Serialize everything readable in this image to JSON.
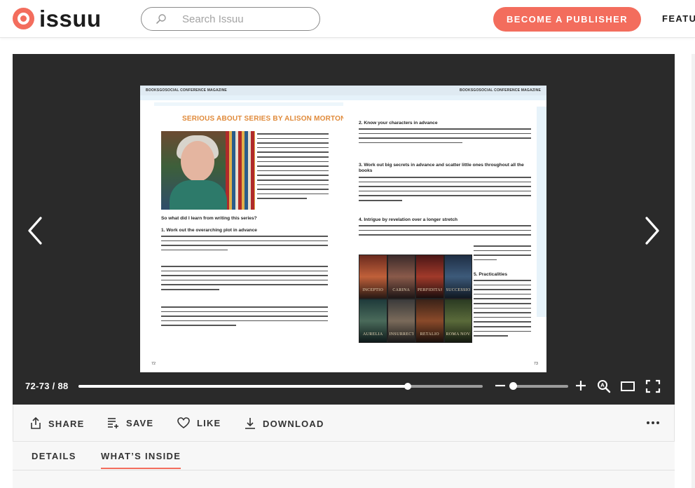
{
  "header": {
    "logo_text": "issuu",
    "search_placeholder": "Search Issuu",
    "publisher_button": "BECOME A PUBLISHER",
    "features_link": "FEATURES",
    "brand_color": "#f36d5d"
  },
  "viewer": {
    "page_indicator": "72-73 / 88",
    "current_pages": "72-73",
    "total_pages": 88,
    "progress_fraction": 0.815,
    "zoom_fraction": 0.0,
    "icons": {
      "prev": "chevron-left-icon",
      "next": "chevron-right-icon",
      "zoom_out": "minus-icon",
      "zoom_in": "plus-icon",
      "zoom_magnifier": "zoom-icon",
      "single_page": "single-page-icon",
      "fullscreen": "fullscreen-icon"
    }
  },
  "document": {
    "left_header": "BOOKSGOSOCIAL CONFERENCE MAGAZINE",
    "right_header": "BOOKSGOSOCIAL CONFERENCE MAGAZINE",
    "article_title": "SERIOUS ABOUT SERIES BY ALISON MORTON",
    "left_subheading_1": "So what did I learn from writing this series?",
    "left_subheading_2": "1. Work out the overarching plot in advance",
    "right_subheading_1": "2. Know your characters in advance",
    "right_subheading_2": "3. Work out big secrets in advance and scatter little ones throughout all the books",
    "right_subheading_3": "4. Intrigue by revelation over a longer stretch",
    "right_subheading_4": "5. Practicalities",
    "left_page_number": "72",
    "right_page_number": "73",
    "covers": [
      "INCEPTIO",
      "CARINA",
      "PERFIDITAS",
      "SUCCESSIO",
      "AURELIA",
      "INSURRECTIO",
      "RETALIO",
      "ROMA NOVA EXTRA"
    ]
  },
  "actions": {
    "share": "SHARE",
    "save": "SAVE",
    "like": "LIKE",
    "download": "DOWNLOAD"
  },
  "tabs": {
    "details": "DETAILS",
    "whats_inside": "WHAT’S INSIDE",
    "active": "whats_inside"
  }
}
